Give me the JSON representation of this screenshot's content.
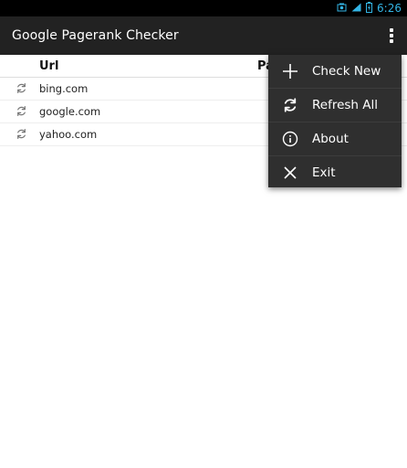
{
  "status_bar": {
    "time": "6:26",
    "accent_color": "#33b5e5",
    "icons": [
      "screenshot-icon",
      "wifi-icon",
      "battery-icon"
    ]
  },
  "action_bar": {
    "title": "Google Pagerank Checker",
    "overflow_icon": "overflow-icon"
  },
  "table": {
    "headers": {
      "url": "Url",
      "pagerank": "Pa"
    },
    "rows": [
      {
        "icon": "refresh-icon",
        "url": "bing.com"
      },
      {
        "icon": "refresh-icon",
        "url": "google.com"
      },
      {
        "icon": "refresh-icon",
        "url": "yahoo.com"
      }
    ]
  },
  "menu": {
    "items": [
      {
        "icon": "plus-icon",
        "label": "Check New"
      },
      {
        "icon": "refresh-icon",
        "label": "Refresh All"
      },
      {
        "icon": "info-icon",
        "label": "About"
      },
      {
        "icon": "close-icon",
        "label": "Exit"
      }
    ]
  }
}
